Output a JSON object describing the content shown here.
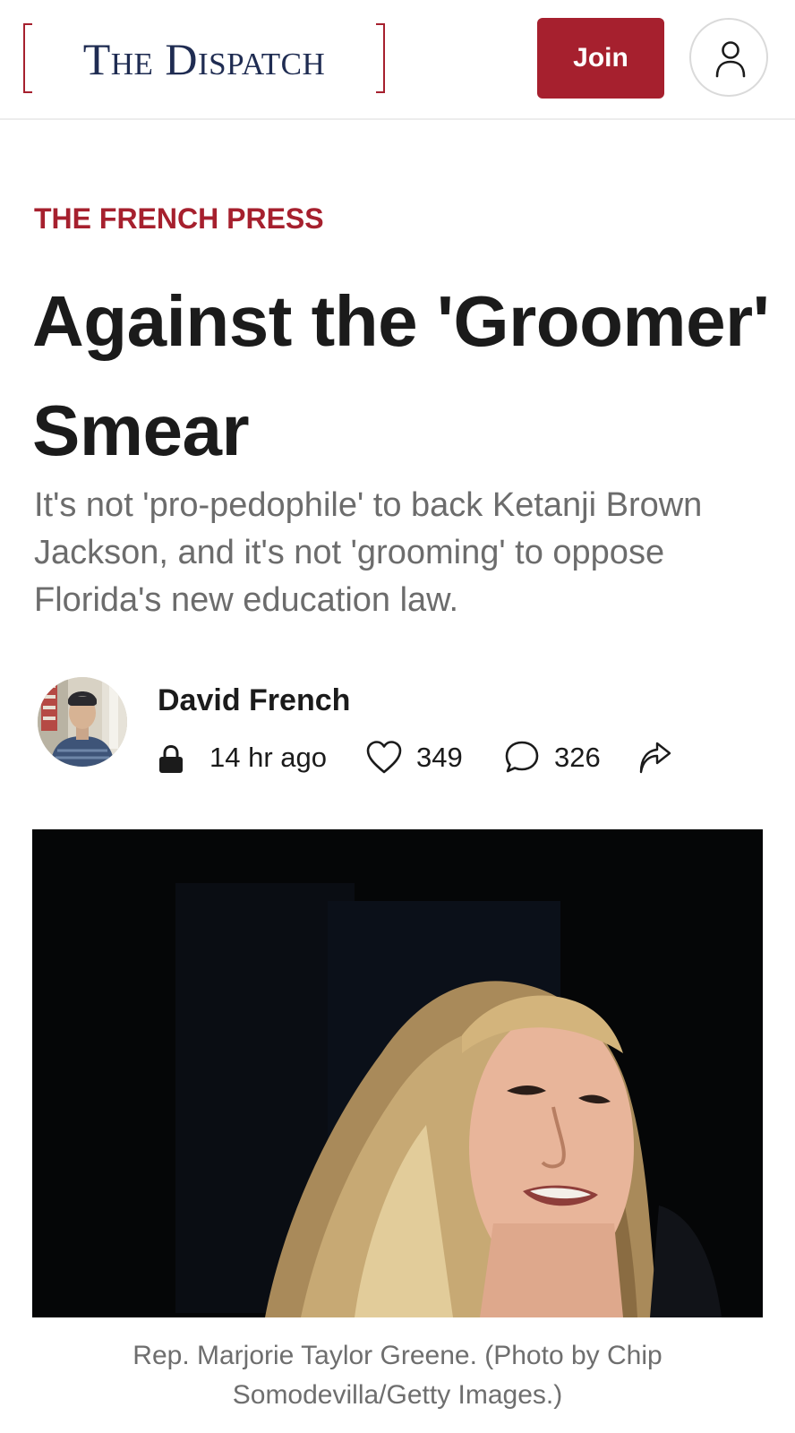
{
  "header": {
    "logo_text": "The Dispatch",
    "join_label": "Join",
    "account_icon": "user-icon"
  },
  "article": {
    "section": "THE FRENCH PRESS",
    "title": "Against the 'Groomer' Smear",
    "subtitle": "It's not 'pro-pedophile' to back Ketanji Brown Jackson, and it's not 'grooming' to oppose Florida's new education law.",
    "author": "David French",
    "meta": {
      "lock_icon": "lock-icon",
      "time_ago": "14 hr ago",
      "likes_icon": "heart-icon",
      "likes": "349",
      "comments_icon": "comment-icon",
      "comments": "326",
      "share_icon": "share-icon"
    },
    "image_caption": "Rep. Marjorie Taylor Greene. (Photo by Chip Somodevilla/Getty Images.)"
  },
  "colors": {
    "brand_red": "#a6202e",
    "logo_navy": "#1f2c52",
    "text_dark": "#1b1b1b",
    "text_muted": "#6c6c6c"
  }
}
